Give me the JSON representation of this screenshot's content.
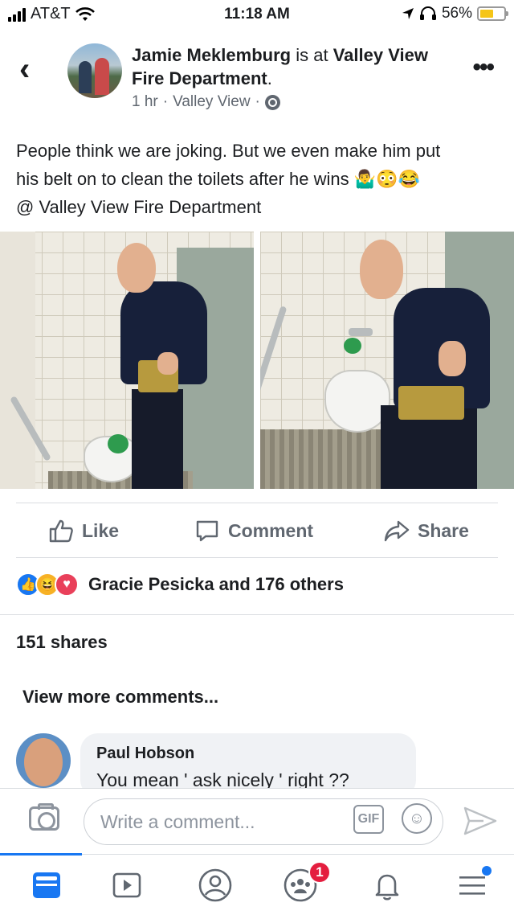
{
  "status_bar": {
    "carrier": "AT&T",
    "time": "11:18 AM",
    "battery": "56%",
    "battery_level": 0.56,
    "icons": [
      "signal-icon",
      "wifi-icon",
      "location-icon",
      "headphones-icon",
      "battery-icon"
    ]
  },
  "post": {
    "author": "Jamie Meklemburg",
    "is_at": "is at",
    "place": "Valley View Fire Department",
    "place_suffix": ".",
    "time": "1 hr",
    "location": "Valley View",
    "separator": "·",
    "text_line1": "People think we are joking. But we even make him put",
    "text_line2": "his belt on to clean the toilets after he wins",
    "emojis": "🤷‍♂️😳😂",
    "text_line3": "@ Valley View Fire Department"
  },
  "actions": {
    "like": "Like",
    "comment": "Comment",
    "share": "Share"
  },
  "reactions": {
    "summary": "Gracie Pesicka and 176 others",
    "types": [
      "like",
      "haha",
      "love"
    ]
  },
  "shares": "151 shares",
  "comments": {
    "view_more": "View more comments...",
    "items": [
      {
        "name": "Paul Hobson",
        "text": "You mean ' ask nicely ' right ??"
      }
    ]
  },
  "composer": {
    "placeholder": "Write a comment...",
    "gif_label": "GIF"
  },
  "tabbar": {
    "tabs": [
      "news-feed-tab",
      "watch-tab",
      "profile-tab",
      "groups-tab",
      "notifications-tab",
      "menu-tab"
    ],
    "groups_badge": "1"
  },
  "colors": {
    "accent": "#1877f2",
    "badge": "#e41e3f",
    "secondary_text": "#606770"
  }
}
